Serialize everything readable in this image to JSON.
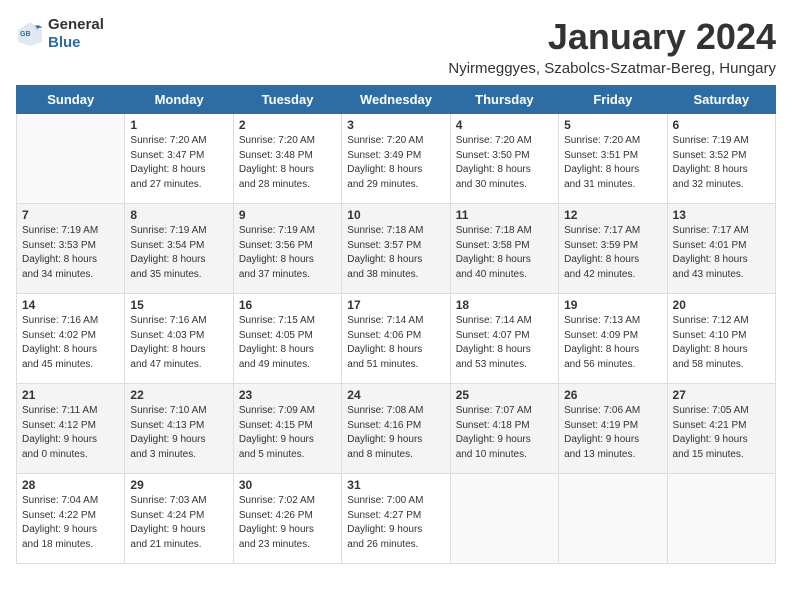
{
  "header": {
    "logo_general": "General",
    "logo_blue": "Blue",
    "title": "January 2024",
    "subtitle": "Nyirmeggyes, Szabolcs-Szatmar-Bereg, Hungary"
  },
  "days_of_week": [
    "Sunday",
    "Monday",
    "Tuesday",
    "Wednesday",
    "Thursday",
    "Friday",
    "Saturday"
  ],
  "weeks": [
    [
      {
        "day": "",
        "info": ""
      },
      {
        "day": "1",
        "info": "Sunrise: 7:20 AM\nSunset: 3:47 PM\nDaylight: 8 hours\nand 27 minutes."
      },
      {
        "day": "2",
        "info": "Sunrise: 7:20 AM\nSunset: 3:48 PM\nDaylight: 8 hours\nand 28 minutes."
      },
      {
        "day": "3",
        "info": "Sunrise: 7:20 AM\nSunset: 3:49 PM\nDaylight: 8 hours\nand 29 minutes."
      },
      {
        "day": "4",
        "info": "Sunrise: 7:20 AM\nSunset: 3:50 PM\nDaylight: 8 hours\nand 30 minutes."
      },
      {
        "day": "5",
        "info": "Sunrise: 7:20 AM\nSunset: 3:51 PM\nDaylight: 8 hours\nand 31 minutes."
      },
      {
        "day": "6",
        "info": "Sunrise: 7:19 AM\nSunset: 3:52 PM\nDaylight: 8 hours\nand 32 minutes."
      }
    ],
    [
      {
        "day": "7",
        "info": "Sunrise: 7:19 AM\nSunset: 3:53 PM\nDaylight: 8 hours\nand 34 minutes."
      },
      {
        "day": "8",
        "info": "Sunrise: 7:19 AM\nSunset: 3:54 PM\nDaylight: 8 hours\nand 35 minutes."
      },
      {
        "day": "9",
        "info": "Sunrise: 7:19 AM\nSunset: 3:56 PM\nDaylight: 8 hours\nand 37 minutes."
      },
      {
        "day": "10",
        "info": "Sunrise: 7:18 AM\nSunset: 3:57 PM\nDaylight: 8 hours\nand 38 minutes."
      },
      {
        "day": "11",
        "info": "Sunrise: 7:18 AM\nSunset: 3:58 PM\nDaylight: 8 hours\nand 40 minutes."
      },
      {
        "day": "12",
        "info": "Sunrise: 7:17 AM\nSunset: 3:59 PM\nDaylight: 8 hours\nand 42 minutes."
      },
      {
        "day": "13",
        "info": "Sunrise: 7:17 AM\nSunset: 4:01 PM\nDaylight: 8 hours\nand 43 minutes."
      }
    ],
    [
      {
        "day": "14",
        "info": "Sunrise: 7:16 AM\nSunset: 4:02 PM\nDaylight: 8 hours\nand 45 minutes."
      },
      {
        "day": "15",
        "info": "Sunrise: 7:16 AM\nSunset: 4:03 PM\nDaylight: 8 hours\nand 47 minutes."
      },
      {
        "day": "16",
        "info": "Sunrise: 7:15 AM\nSunset: 4:05 PM\nDaylight: 8 hours\nand 49 minutes."
      },
      {
        "day": "17",
        "info": "Sunrise: 7:14 AM\nSunset: 4:06 PM\nDaylight: 8 hours\nand 51 minutes."
      },
      {
        "day": "18",
        "info": "Sunrise: 7:14 AM\nSunset: 4:07 PM\nDaylight: 8 hours\nand 53 minutes."
      },
      {
        "day": "19",
        "info": "Sunrise: 7:13 AM\nSunset: 4:09 PM\nDaylight: 8 hours\nand 56 minutes."
      },
      {
        "day": "20",
        "info": "Sunrise: 7:12 AM\nSunset: 4:10 PM\nDaylight: 8 hours\nand 58 minutes."
      }
    ],
    [
      {
        "day": "21",
        "info": "Sunrise: 7:11 AM\nSunset: 4:12 PM\nDaylight: 9 hours\nand 0 minutes."
      },
      {
        "day": "22",
        "info": "Sunrise: 7:10 AM\nSunset: 4:13 PM\nDaylight: 9 hours\nand 3 minutes."
      },
      {
        "day": "23",
        "info": "Sunrise: 7:09 AM\nSunset: 4:15 PM\nDaylight: 9 hours\nand 5 minutes."
      },
      {
        "day": "24",
        "info": "Sunrise: 7:08 AM\nSunset: 4:16 PM\nDaylight: 9 hours\nand 8 minutes."
      },
      {
        "day": "25",
        "info": "Sunrise: 7:07 AM\nSunset: 4:18 PM\nDaylight: 9 hours\nand 10 minutes."
      },
      {
        "day": "26",
        "info": "Sunrise: 7:06 AM\nSunset: 4:19 PM\nDaylight: 9 hours\nand 13 minutes."
      },
      {
        "day": "27",
        "info": "Sunrise: 7:05 AM\nSunset: 4:21 PM\nDaylight: 9 hours\nand 15 minutes."
      }
    ],
    [
      {
        "day": "28",
        "info": "Sunrise: 7:04 AM\nSunset: 4:22 PM\nDaylight: 9 hours\nand 18 minutes."
      },
      {
        "day": "29",
        "info": "Sunrise: 7:03 AM\nSunset: 4:24 PM\nDaylight: 9 hours\nand 21 minutes."
      },
      {
        "day": "30",
        "info": "Sunrise: 7:02 AM\nSunset: 4:26 PM\nDaylight: 9 hours\nand 23 minutes."
      },
      {
        "day": "31",
        "info": "Sunrise: 7:00 AM\nSunset: 4:27 PM\nDaylight: 9 hours\nand 26 minutes."
      },
      {
        "day": "",
        "info": ""
      },
      {
        "day": "",
        "info": ""
      },
      {
        "day": "",
        "info": ""
      }
    ]
  ]
}
